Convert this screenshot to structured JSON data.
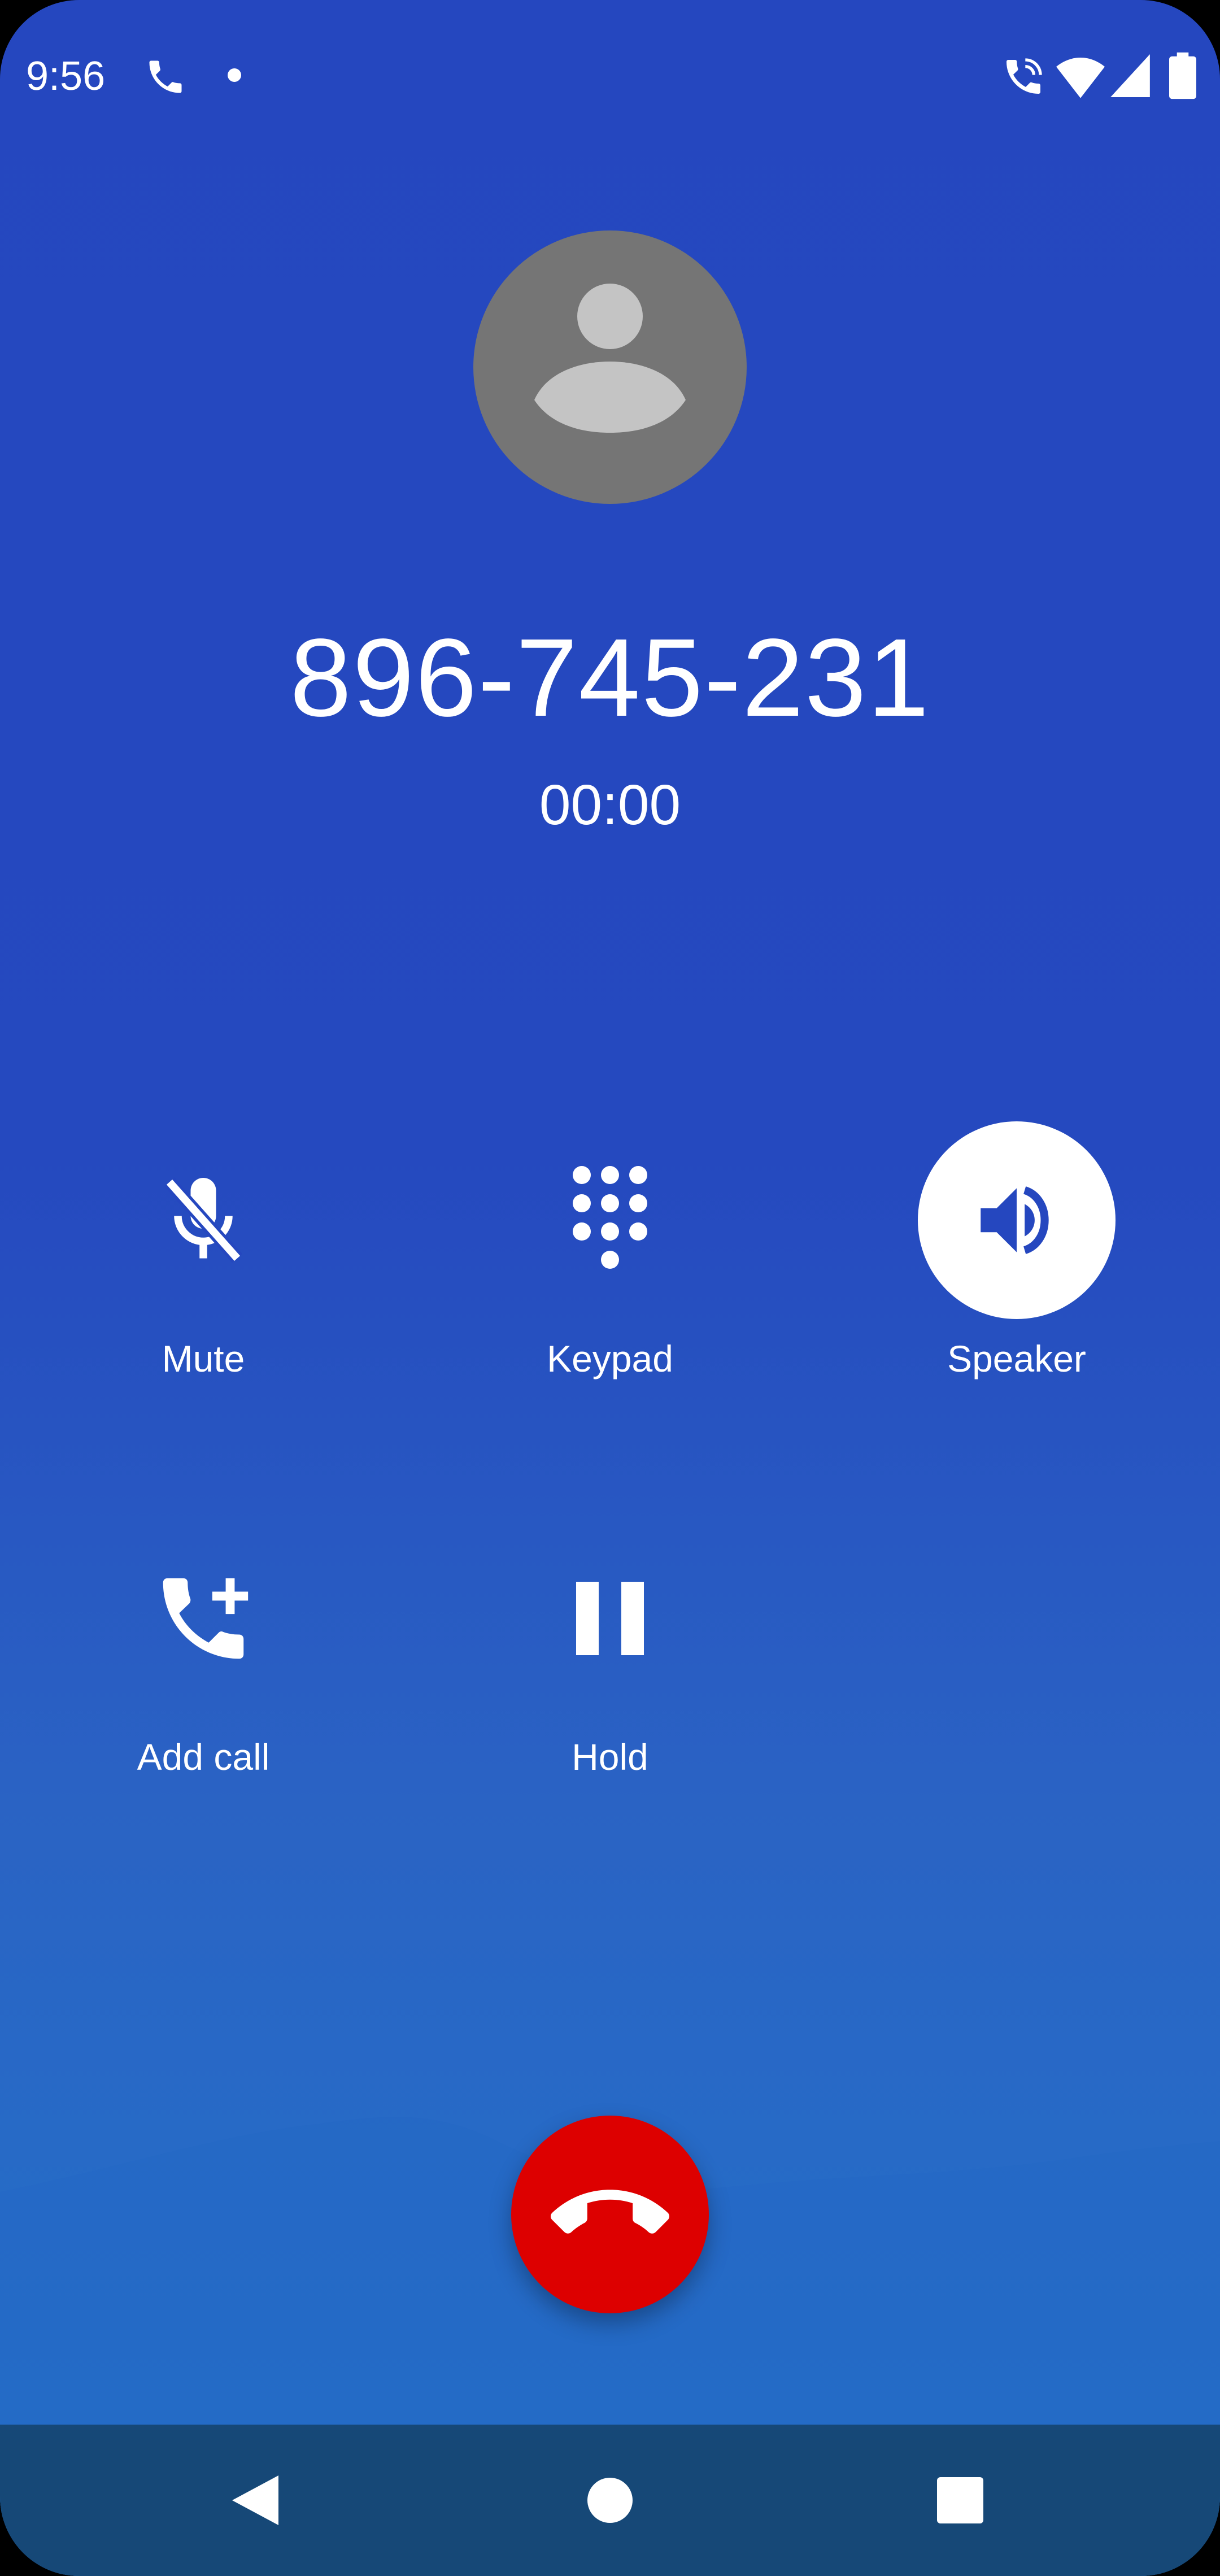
{
  "status_bar": {
    "time": "9:56",
    "icons": [
      "phone-icon",
      "notification-dot-icon",
      "wifi-calling-icon",
      "wifi-icon",
      "signal-icon",
      "battery-icon"
    ]
  },
  "call": {
    "number": "896-745-231",
    "timer": "00:00"
  },
  "controls": [
    {
      "label": "Mute",
      "icon": "mic-off-icon",
      "active": false
    },
    {
      "label": "Keypad",
      "icon": "dialpad-icon",
      "active": false
    },
    {
      "label": "Speaker",
      "icon": "volume-up-icon",
      "active": true
    },
    {
      "label": "Add call",
      "icon": "add-call-icon",
      "active": false
    },
    {
      "label": "Hold",
      "icon": "pause-icon",
      "active": false
    }
  ],
  "end_call": {
    "icon": "call-end-icon"
  },
  "nav": {
    "icons": [
      "back-icon",
      "home-icon",
      "recents-icon"
    ]
  },
  "colors": {
    "background": "#2547bf",
    "end_call": "#dd0000",
    "nav_bar": "#164877",
    "avatar": "#757575",
    "active_button": "#ffffff"
  }
}
